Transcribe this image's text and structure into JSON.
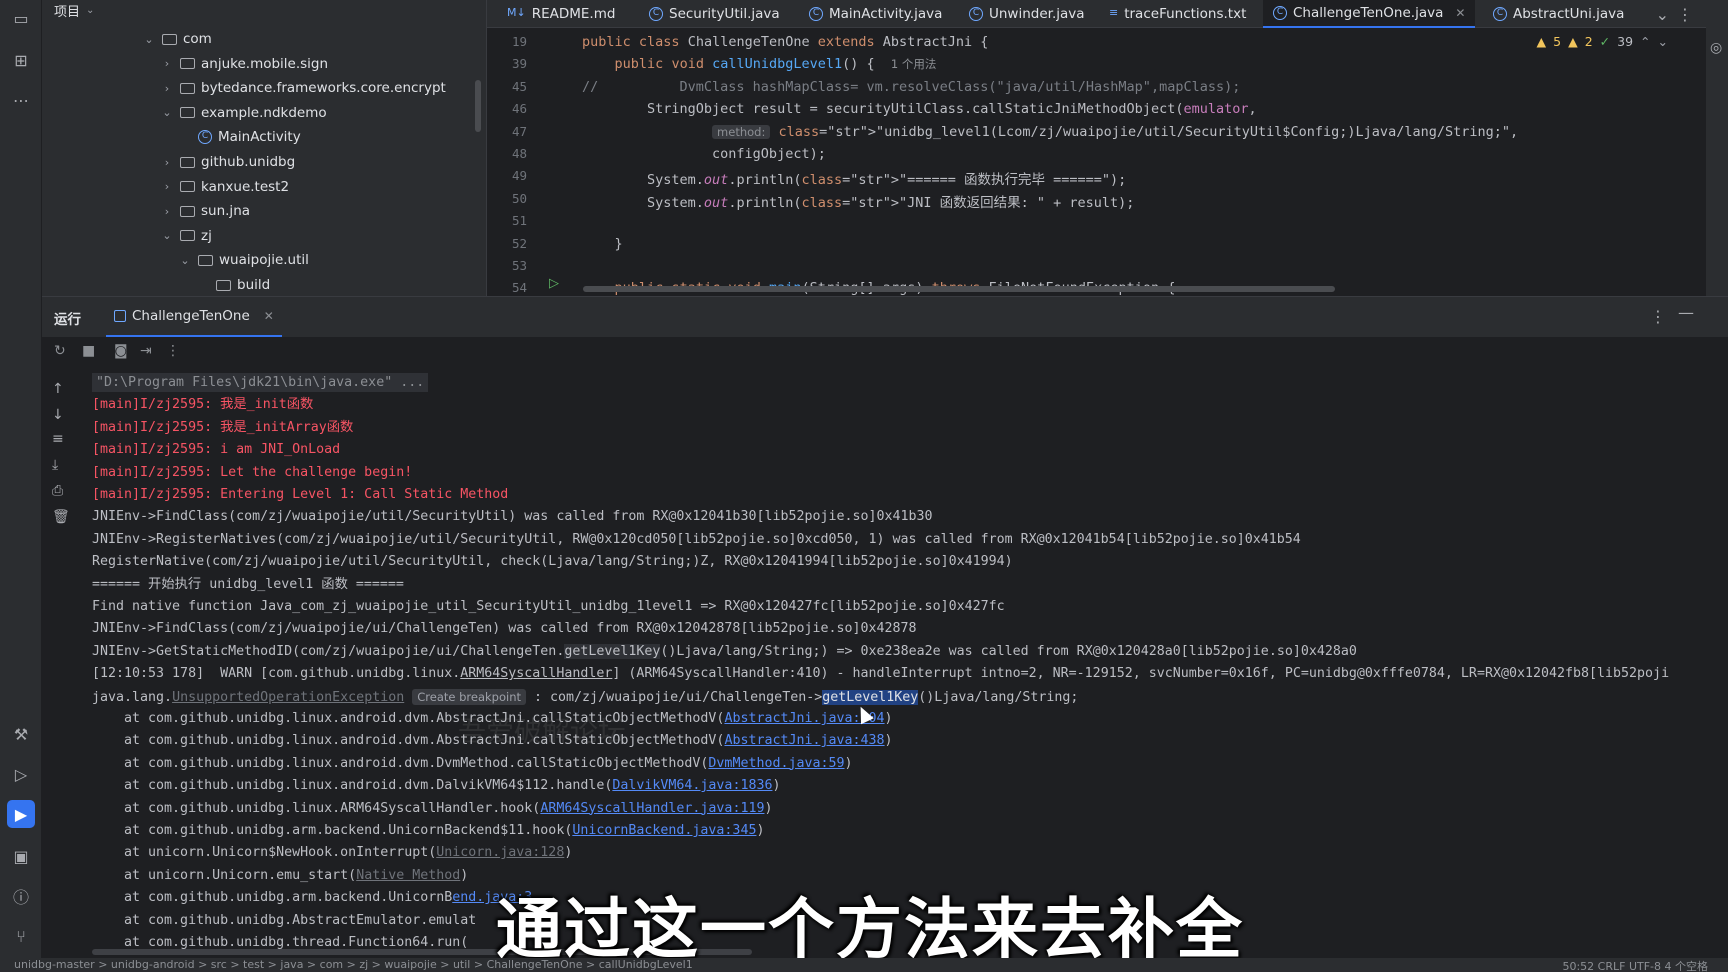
{
  "project": {
    "title": "项目",
    "tree": [
      {
        "label": "com",
        "kind": "folder",
        "state": "open"
      },
      {
        "label": "anjuke.mobile.sign",
        "kind": "folder",
        "state": "closed"
      },
      {
        "label": "bytedance.frameworks.core.encrypt",
        "kind": "folder",
        "state": "closed"
      },
      {
        "label": "example.ndkdemo",
        "kind": "folder",
        "state": "open"
      },
      {
        "label": "MainActivity",
        "kind": "class",
        "state": ""
      },
      {
        "label": "github.unidbg",
        "kind": "folder",
        "state": "closed"
      },
      {
        "label": "kanxue.test2",
        "kind": "folder",
        "state": "closed"
      },
      {
        "label": "sun.jna",
        "kind": "folder",
        "state": "closed"
      },
      {
        "label": "zj",
        "kind": "folder",
        "state": "open"
      },
      {
        "label": "wuaipojie.util",
        "kind": "folder",
        "state": "open"
      },
      {
        "label": "build",
        "kind": "folder",
        "state": ""
      }
    ]
  },
  "editor": {
    "tabs": [
      {
        "label": "README.md",
        "prefix": "M↓"
      },
      {
        "label": "SecurityUtil.java",
        "prefix": "C"
      },
      {
        "label": "MainActivity.java",
        "prefix": "C"
      },
      {
        "label": "Unwinder.java",
        "prefix": "C"
      },
      {
        "label": "traceFunctions.txt",
        "prefix": "≡"
      },
      {
        "label": "ChallengeTenOne.java",
        "prefix": "C"
      },
      {
        "label": "AbstractUni.java",
        "prefix": "C"
      }
    ],
    "active_tab": "ChallengeTenOne.java",
    "inspections": {
      "warnings": "5",
      "weak_warnings": "2",
      "ok": "39"
    },
    "lines": [
      {
        "n": "19",
        "code": "public class ChallengeTenOne extends AbstractJni {"
      },
      {
        "n": "39",
        "code": "    public void callUnidbgLevel1() {",
        "usage": "1 个用法"
      },
      {
        "n": "45",
        "code": "//          DvmClass hashMapClass= vm.resolveClass(\"java/util/HashMap\",mapClass);"
      },
      {
        "n": "46",
        "code": "        StringObject result = securityUtilClass.callStaticJniMethodObject(emulator,"
      },
      {
        "n": "47",
        "hint": "method:",
        "code": "\"unidbg_level1(Lcom/zj/wuaipojie/util/SecurityUtil$Config;)Ljava/lang/String;\","
      },
      {
        "n": "48",
        "code": "                configObject);"
      },
      {
        "n": "49",
        "code": "        System.out.println(\"====== 函数执行完毕 ======\");"
      },
      {
        "n": "50",
        "code": "        System.out.println(\"JNI 函数返回结果: \" + result);"
      },
      {
        "n": "51",
        "code": ""
      },
      {
        "n": "52",
        "code": "    }"
      },
      {
        "n": "53",
        "code": ""
      },
      {
        "n": "54",
        "code": "    public static void main(String[] args) throws FileNotFoundException {"
      }
    ]
  },
  "run": {
    "title": "运行",
    "tab_label": "ChallengeTenOne",
    "console": [
      {
        "t": "\"D:\\Program Files\\jdk21\\bin\\java.exe\" ...",
        "c": "cmd"
      },
      {
        "t": "[main]I/zj2595: 我是_init函数",
        "c": "red"
      },
      {
        "t": "[main]I/zj2595: 我是_initArray函数",
        "c": "red"
      },
      {
        "t": "[main]I/zj2595: i am JNI_OnLoad",
        "c": "red"
      },
      {
        "t": "[main]I/zj2595: Let the challenge begin!",
        "c": "red"
      },
      {
        "t": "[main]I/zj2595: Entering Level 1: Call Static Method",
        "c": "red"
      },
      {
        "t": "JNIEnv->FindClass(com/zj/wuaipojie/util/SecurityUtil) was called from RX@0x12041b30[lib52pojie.so]0x41b30",
        "c": ""
      },
      {
        "t": "JNIEnv->RegisterNatives(com/zj/wuaipojie/util/SecurityUtil, RW@0x120cd050[lib52pojie.so]0xcd050, 1) was called from RX@0x12041b54[lib52pojie.so]0x41b54",
        "c": ""
      },
      {
        "t": "RegisterNative(com/zj/wuaipojie/util/SecurityUtil, check(Ljava/lang/String;)Z, RX@0x12041994[lib52pojie.so]0x41994)",
        "c": ""
      },
      {
        "t": "====== 开始执行 unidbg_level1 函数 ======",
        "c": ""
      },
      {
        "t": "Find native function Java_com_zj_wuaipojie_util_SecurityUtil_unidbg_1level1 => RX@0x120427fc[lib52pojie.so]0x427fc",
        "c": ""
      },
      {
        "t": "JNIEnv->FindClass(com/zj/wuaipojie/ui/ChallengeTen) was called from RX@0x12042878[lib52pojie.so]0x42878",
        "c": ""
      },
      {
        "t": "JNIEnv->GetStaticMethodID(com/zj/wuaipojie/ui/ChallengeTen.getLevel1Key()Ljava/lang/String;) => 0xe238ea2e was called from RX@0x120428a0[lib52pojie.so]0x428a0",
        "c": ""
      },
      {
        "t": "[12:10:53 178]  WARN [com.github.unidbg.linux.ARM64SyscallHandler] (ARM64SyscallHandler:410) - handleInterrupt intno=2, NR=-129152, svcNumber=0x16f, PC=unidbg@0xfffe0784, LR=RX@0x12042fb8[lib52poji",
        "c": ""
      }
    ],
    "exception": {
      "prefix": "java.lang.",
      "name": "UnsupportedOperationException",
      "chip": "Create breakpoint",
      "mid": " : com/zj/wuaipojie/ui/ChallengeTen->",
      "sel": "getLevel1Key",
      "suffix": "()Ljava/lang/String;"
    },
    "stack": [
      {
        "pre": "    at com.github.unidbg.linux.android.dvm.AbstractJni.callStaticObjectMethodV(",
        "link": "AbstractJni.java:504",
        "post": ")",
        "grey": false
      },
      {
        "pre": "    at com.github.unidbg.linux.android.dvm.AbstractJni.callStaticObjectMethodV(",
        "link": "AbstractJni.java:438",
        "post": ")",
        "grey": false
      },
      {
        "pre": "    at com.github.unidbg.linux.android.dvm.DvmMethod.callStaticObjectMethodV(",
        "link": "DvmMethod.java:59",
        "post": ")",
        "grey": false
      },
      {
        "pre": "    at com.github.unidbg.linux.android.dvm.DalvikVM64$112.handle(",
        "link": "DalvikVM64.java:1836",
        "post": ")",
        "grey": false
      },
      {
        "pre": "    at com.github.unidbg.linux.ARM64SyscallHandler.hook(",
        "link": "ARM64SyscallHandler.java:119",
        "post": ")",
        "grey": false
      },
      {
        "pre": "    at com.github.unidbg.arm.backend.UnicornBackend$11.hook(",
        "link": "UnicornBackend.java:345",
        "post": ")",
        "grey": false
      },
      {
        "pre": "    at unicorn.Unicorn$NewHook.onInterrupt(",
        "link": "Unicorn.java:128",
        "post": ")",
        "grey": true
      },
      {
        "pre": "    at unicorn.Unicorn.emu_start(",
        "link": "Native Method",
        "post": ")",
        "grey": true
      },
      {
        "pre": "    at com.github.unidbg.arm.backend.UnicornB",
        "link": "end.java:3",
        "post": "",
        "grey": false
      },
      {
        "pre": "    at com.github.unidbg.AbstractEmulator.emulat",
        "link": "",
        "post": "",
        "grey": false
      },
      {
        "pre": "    at com.github.unidbg.thread.Function64.run(",
        "link": "",
        "post": "",
        "grey": false
      }
    ]
  },
  "status": {
    "breadcrumb": "unidbg-master  >  unidbg-android  >  src  >  test  >  java  >  com  >  zj  >  wuaipojie  >  util  >  ChallengeTenOne  >  callUnidbgLevel1",
    "right": "50:52    CRLF    UTF-8    4 个空格"
  },
  "subtitle": "通过这一个方法来去补全",
  "watermark": "吾爱破解论坛"
}
